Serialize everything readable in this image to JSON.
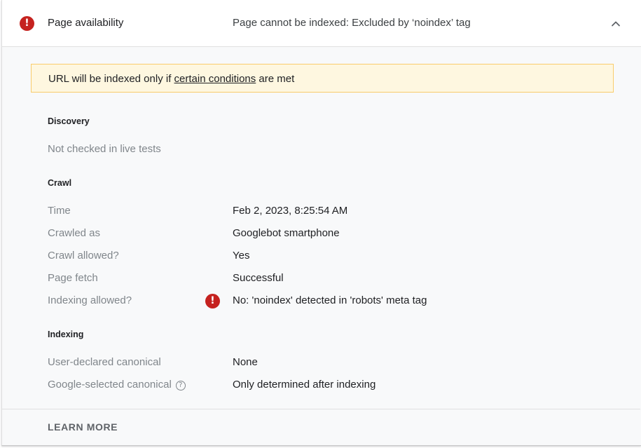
{
  "header": {
    "title": "Page availability",
    "status": "Page cannot be indexed: Excluded by ‘noindex’ tag",
    "error_icon": "!",
    "collapse_icon": "chevron-up-icon"
  },
  "banner": {
    "prefix": "URL will be indexed only if ",
    "link": "certain conditions",
    "suffix": " are met"
  },
  "sections": {
    "discovery": {
      "title": "Discovery",
      "note": "Not checked in live tests"
    },
    "crawl": {
      "title": "Crawl",
      "rows": [
        {
          "label": "Time",
          "value": "Feb 2, 2023, 8:25:54 AM"
        },
        {
          "label": "Crawled as",
          "value": "Googlebot smartphone"
        },
        {
          "label": "Crawl allowed?",
          "value": "Yes"
        },
        {
          "label": "Page fetch",
          "value": "Successful"
        },
        {
          "label": "Indexing allowed?",
          "value": "No: 'noindex' detected in 'robots' meta tag",
          "error_icon": "!"
        }
      ]
    },
    "indexing": {
      "title": "Indexing",
      "rows": [
        {
          "label": "User-declared canonical",
          "value": "None"
        },
        {
          "label": "Google-selected canonical",
          "value": "Only determined after indexing",
          "help_icon": "?"
        }
      ]
    }
  },
  "footer": {
    "learn_more": "LEARN MORE"
  },
  "colors": {
    "error": "#c5221f",
    "banner_bg": "#fef7e0",
    "banner_border": "#f9cc6b",
    "label_gray": "#80868b"
  }
}
